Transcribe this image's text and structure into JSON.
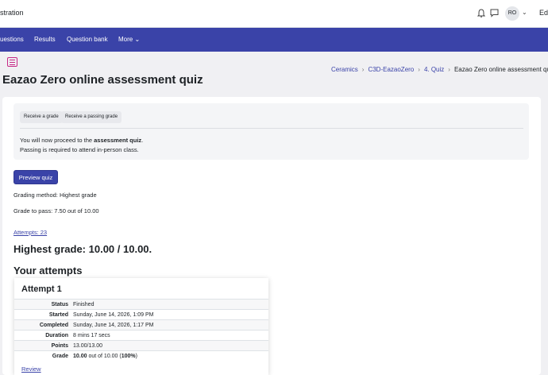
{
  "topbar": {
    "site_name": "stration",
    "avatar_initials": "RO",
    "edit_label": "Edi"
  },
  "nav": {
    "items": [
      {
        "label": "uestions"
      },
      {
        "label": "Results"
      },
      {
        "label": "Question bank"
      },
      {
        "label": "More"
      }
    ]
  },
  "page": {
    "title": "Eazao Zero online assessment quiz",
    "breadcrumb": [
      "Ceramics",
      "C3D-EazaoZero",
      "4. Quiz",
      "Eazao Zero online assessment quiz"
    ]
  },
  "activity": {
    "chips": [
      "Receive a grade",
      "Receive a passing grade"
    ],
    "intro_prefix": "You will now proceed to the ",
    "intro_bold": "assessment quiz",
    "intro_suffix": ".",
    "intro_line2": "Passing is required to attend in-person class."
  },
  "quiz": {
    "preview_label": "Preview quiz",
    "grading_method": "Grading method: Highest grade",
    "grade_to_pass": "Grade to pass: 7.50 out of 10.00",
    "attempts_link": "Attempts: 23",
    "highest_grade": "Highest grade: 10.00 / 10.00.",
    "your_attempts": "Your attempts"
  },
  "attempt": {
    "heading": "Attempt 1",
    "rows": [
      {
        "label": "Status",
        "value": "Finished"
      },
      {
        "label": "Started",
        "value": "Sunday, June 14, 2026, 1:09 PM"
      },
      {
        "label": "Completed",
        "value": "Sunday, June 14, 2026, 1:17 PM"
      },
      {
        "label": "Duration",
        "value": "8 mins 17 secs"
      },
      {
        "label": "Points",
        "value": "13.00/13.00"
      }
    ],
    "grade_label": "Grade",
    "grade_bold": "10.00",
    "grade_mid": " out of 10.00 (",
    "grade_pct": "100%",
    "grade_end": ")",
    "review_label": "Review"
  },
  "colors": {
    "brand": "#3a43a8",
    "quiz_icon": "#c62886"
  },
  "icons": [
    "bell-icon",
    "message-icon",
    "chevron-down-icon",
    "quiz-icon",
    "breadcrumb-separator-icon"
  ]
}
